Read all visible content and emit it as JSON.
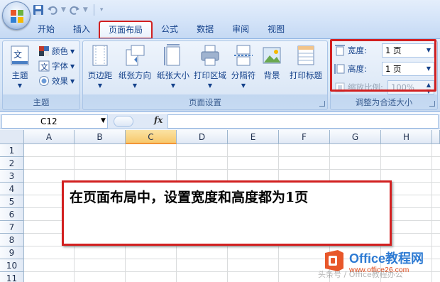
{
  "qat": {
    "undo_icon": "undo-icon",
    "redo_icon": "redo-icon",
    "save_icon": "save-icon"
  },
  "tabs": [
    {
      "label": "开始"
    },
    {
      "label": "插入"
    },
    {
      "label": "页面布局",
      "active": true
    },
    {
      "label": "公式"
    },
    {
      "label": "数据"
    },
    {
      "label": "审阅"
    },
    {
      "label": "视图"
    }
  ],
  "ribbon": {
    "theme_group": {
      "label": "主题",
      "theme_button": "主题",
      "colors": "颜色",
      "fonts": "字体",
      "effects": "效果"
    },
    "page_setup_group": {
      "label": "页面设置",
      "buttons": [
        "页边距",
        "纸张方向",
        "纸张大小",
        "打印区域",
        "分隔符",
        "背景",
        "打印标题"
      ]
    },
    "scale_group": {
      "label": "调整为合适大小",
      "width_label": "宽度:",
      "width_value": "1 页",
      "height_label": "高度:",
      "height_value": "1 页",
      "scale_label": "缩放比例:",
      "scale_value": "100%"
    }
  },
  "formula_bar": {
    "name_box": "C12",
    "fx": "fx",
    "formula": ""
  },
  "grid": {
    "columns": [
      "A",
      "B",
      "C",
      "D",
      "E",
      "F",
      "G",
      "H"
    ],
    "selected_column": "C",
    "rows": [
      "1",
      "2",
      "3",
      "4",
      "5",
      "6",
      "7",
      "8",
      "9",
      "10",
      "11"
    ]
  },
  "annotation": {
    "text": "在页面布局中，设置宽度和高度都为1页"
  },
  "watermark": {
    "brand": "Office教程网",
    "url": "www.office26.com",
    "faint": "头条号 / Office教程办公"
  },
  "colors": {
    "highlight": "#d22020",
    "ribbon_text": "#15428b",
    "selected_header": "#f7c86c"
  }
}
